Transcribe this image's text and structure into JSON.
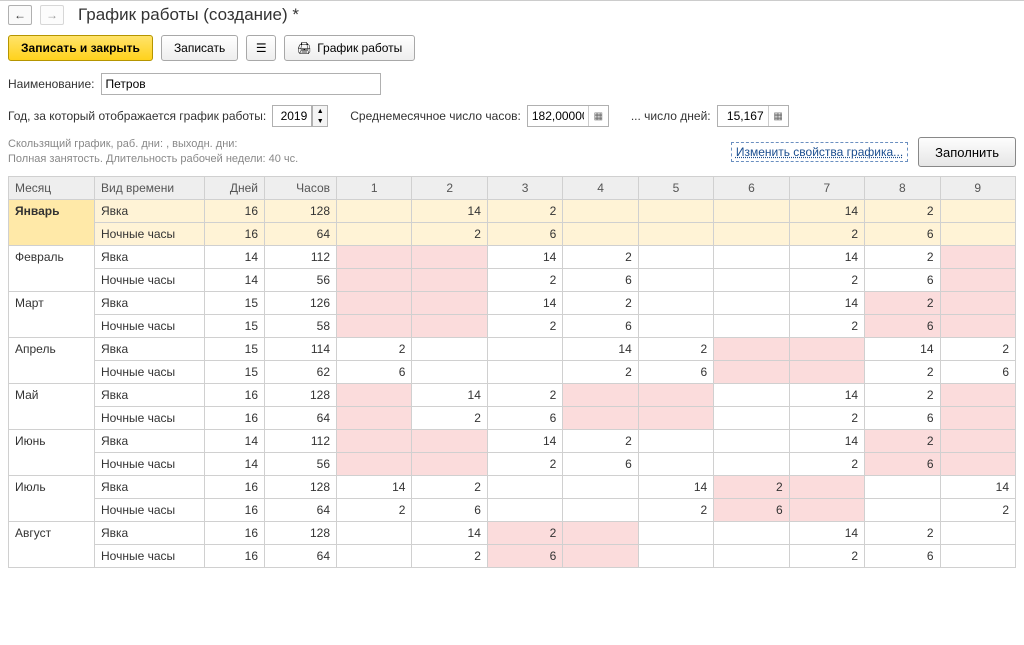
{
  "header": {
    "title": "График работы (создание) *"
  },
  "toolbar": {
    "save_close": "Записать и закрыть",
    "save": "Записать",
    "print_label": "График работы"
  },
  "fields": {
    "name_label": "Наименование:",
    "name_value": "Петров",
    "year_label": "Год, за который отображается график работы:",
    "year_value": "2019",
    "avg_hours_label": "Среднемесячное число часов:",
    "avg_hours_value": "182,00000",
    "avg_days_label": "... число дней:",
    "avg_days_value": "15,167"
  },
  "info": {
    "line1": "Скользящий график, раб. дни: , выходн. дни:",
    "line2": "Полная занятость. Длительность рабочей недели: 40 чс."
  },
  "actions": {
    "change_props": "Изменить свойства графика...",
    "fill": "Заполнить"
  },
  "table": {
    "headers": {
      "month": "Месяц",
      "type": "Вид времени",
      "days": "Дней",
      "hours": "Часов"
    },
    "day_headers": [
      "1",
      "2",
      "3",
      "4",
      "5",
      "6",
      "7",
      "8",
      "9"
    ],
    "type_attend": "Явка",
    "type_night": "Ночные часы",
    "months": [
      {
        "name": "Январь",
        "selected": true,
        "attend": {
          "days": "16",
          "hours": "128",
          "cells": [
            {
              "v": "",
              "c": "lpink"
            },
            {
              "v": "14"
            },
            {
              "v": "2"
            },
            {
              "v": ""
            },
            {
              "v": ""
            },
            {
              "v": ""
            },
            {
              "v": "14"
            },
            {
              "v": "2"
            },
            {
              "v": "",
              "c": "lpink"
            }
          ]
        },
        "night": {
          "days": "16",
          "hours": "64",
          "cells": [
            {
              "v": "",
              "c": "pink"
            },
            {
              "v": "2"
            },
            {
              "v": "6"
            },
            {
              "v": "",
              "c": "pink"
            },
            {
              "v": "",
              "c": "pink"
            },
            {
              "v": ""
            },
            {
              "v": "2"
            },
            {
              "v": "6"
            },
            {
              "v": "",
              "c": "pink"
            }
          ]
        }
      },
      {
        "name": "Февраль",
        "attend": {
          "days": "14",
          "hours": "112",
          "cells": [
            {
              "v": "",
              "c": "pink"
            },
            {
              "v": "",
              "c": "pink"
            },
            {
              "v": "14"
            },
            {
              "v": "2"
            },
            {
              "v": ""
            },
            {
              "v": ""
            },
            {
              "v": "14"
            },
            {
              "v": "2"
            },
            {
              "v": "",
              "c": "pink"
            }
          ]
        },
        "night": {
          "days": "14",
          "hours": "56",
          "cells": [
            {
              "v": "",
              "c": "pink"
            },
            {
              "v": "",
              "c": "pink"
            },
            {
              "v": "2"
            },
            {
              "v": "6"
            },
            {
              "v": ""
            },
            {
              "v": ""
            },
            {
              "v": "2"
            },
            {
              "v": "6"
            },
            {
              "v": "",
              "c": "pink"
            }
          ]
        }
      },
      {
        "name": "Март",
        "attend": {
          "days": "15",
          "hours": "126",
          "cells": [
            {
              "v": "",
              "c": "pink"
            },
            {
              "v": "",
              "c": "pink"
            },
            {
              "v": "14"
            },
            {
              "v": "2"
            },
            {
              "v": ""
            },
            {
              "v": ""
            },
            {
              "v": "14"
            },
            {
              "v": "2",
              "c": "pink"
            },
            {
              "v": "",
              "c": "pink"
            }
          ]
        },
        "night": {
          "days": "15",
          "hours": "58",
          "cells": [
            {
              "v": "",
              "c": "pink"
            },
            {
              "v": "",
              "c": "pink"
            },
            {
              "v": "2"
            },
            {
              "v": "6"
            },
            {
              "v": ""
            },
            {
              "v": ""
            },
            {
              "v": "2"
            },
            {
              "v": "6",
              "c": "pink"
            },
            {
              "v": "",
              "c": "pink"
            }
          ]
        }
      },
      {
        "name": "Апрель",
        "attend": {
          "days": "15",
          "hours": "114",
          "cells": [
            {
              "v": "2"
            },
            {
              "v": ""
            },
            {
              "v": ""
            },
            {
              "v": "14"
            },
            {
              "v": "2"
            },
            {
              "v": "",
              "c": "pink"
            },
            {
              "v": "",
              "c": "pink"
            },
            {
              "v": "14"
            },
            {
              "v": "2"
            }
          ]
        },
        "night": {
          "days": "15",
          "hours": "62",
          "cells": [
            {
              "v": "6"
            },
            {
              "v": ""
            },
            {
              "v": ""
            },
            {
              "v": "2"
            },
            {
              "v": "6"
            },
            {
              "v": "",
              "c": "pink"
            },
            {
              "v": "",
              "c": "pink"
            },
            {
              "v": "2"
            },
            {
              "v": "6"
            }
          ]
        }
      },
      {
        "name": "Май",
        "attend": {
          "days": "16",
          "hours": "128",
          "cells": [
            {
              "v": "",
              "c": "pink"
            },
            {
              "v": "14"
            },
            {
              "v": "2"
            },
            {
              "v": "",
              "c": "pink"
            },
            {
              "v": "",
              "c": "pink"
            },
            {
              "v": ""
            },
            {
              "v": "14"
            },
            {
              "v": "2"
            },
            {
              "v": "",
              "c": "pink"
            }
          ]
        },
        "night": {
          "days": "16",
          "hours": "64",
          "cells": [
            {
              "v": "",
              "c": "pink"
            },
            {
              "v": "2"
            },
            {
              "v": "6"
            },
            {
              "v": "",
              "c": "pink"
            },
            {
              "v": "",
              "c": "pink"
            },
            {
              "v": ""
            },
            {
              "v": "2"
            },
            {
              "v": "6"
            },
            {
              "v": "",
              "c": "pink"
            }
          ]
        }
      },
      {
        "name": "Июнь",
        "attend": {
          "days": "14",
          "hours": "112",
          "cells": [
            {
              "v": "",
              "c": "pink"
            },
            {
              "v": "",
              "c": "pink"
            },
            {
              "v": "14"
            },
            {
              "v": "2"
            },
            {
              "v": ""
            },
            {
              "v": ""
            },
            {
              "v": "14"
            },
            {
              "v": "2",
              "c": "pink"
            },
            {
              "v": "",
              "c": "pink"
            }
          ]
        },
        "night": {
          "days": "14",
          "hours": "56",
          "cells": [
            {
              "v": "",
              "c": "pink"
            },
            {
              "v": "",
              "c": "pink"
            },
            {
              "v": "2"
            },
            {
              "v": "6"
            },
            {
              "v": ""
            },
            {
              "v": ""
            },
            {
              "v": "2"
            },
            {
              "v": "6",
              "c": "pink"
            },
            {
              "v": "",
              "c": "pink"
            }
          ]
        }
      },
      {
        "name": "Июль",
        "attend": {
          "days": "16",
          "hours": "128",
          "cells": [
            {
              "v": "14"
            },
            {
              "v": "2"
            },
            {
              "v": ""
            },
            {
              "v": ""
            },
            {
              "v": "14"
            },
            {
              "v": "2",
              "c": "pink"
            },
            {
              "v": "",
              "c": "pink"
            },
            {
              "v": ""
            },
            {
              "v": "14"
            }
          ]
        },
        "night": {
          "days": "16",
          "hours": "64",
          "cells": [
            {
              "v": "2"
            },
            {
              "v": "6"
            },
            {
              "v": ""
            },
            {
              "v": ""
            },
            {
              "v": "2"
            },
            {
              "v": "6",
              "c": "pink"
            },
            {
              "v": "",
              "c": "pink"
            },
            {
              "v": ""
            },
            {
              "v": "2"
            }
          ]
        }
      },
      {
        "name": "Август",
        "attend": {
          "days": "16",
          "hours": "128",
          "cells": [
            {
              "v": ""
            },
            {
              "v": "14"
            },
            {
              "v": "2",
              "c": "pink"
            },
            {
              "v": "",
              "c": "pink"
            },
            {
              "v": ""
            },
            {
              "v": ""
            },
            {
              "v": "14"
            },
            {
              "v": "2"
            },
            {
              "v": ""
            }
          ]
        },
        "night": {
          "days": "16",
          "hours": "64",
          "cells": [
            {
              "v": ""
            },
            {
              "v": "2"
            },
            {
              "v": "6",
              "c": "pink"
            },
            {
              "v": "",
              "c": "pink"
            },
            {
              "v": ""
            },
            {
              "v": ""
            },
            {
              "v": "2"
            },
            {
              "v": "6"
            },
            {
              "v": ""
            }
          ]
        }
      }
    ]
  }
}
